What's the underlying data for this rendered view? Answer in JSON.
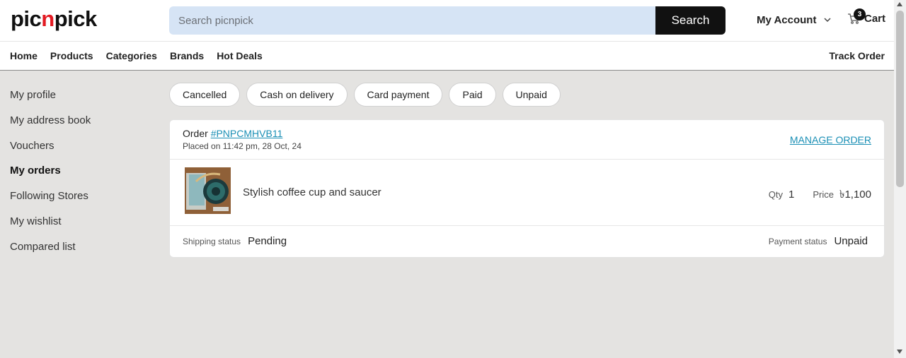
{
  "header": {
    "logo_pre": "pic",
    "logo_n": "n",
    "logo_post": "pick",
    "search_placeholder": "Search picnpick",
    "search_button": "Search",
    "account_label": "My Account",
    "cart_label": "Cart",
    "cart_count": "3"
  },
  "nav": {
    "items": [
      "Home",
      "Products",
      "Categories",
      "Brands",
      "Hot Deals"
    ],
    "track_order": "Track Order"
  },
  "sidebar": {
    "items": [
      "My profile",
      "My address book",
      "Vouchers",
      "My orders",
      "Following Stores",
      "My wishlist",
      "Compared list"
    ],
    "active": "My orders"
  },
  "filters": [
    "Cancelled",
    "Cash on delivery",
    "Card payment",
    "Paid",
    "Unpaid"
  ],
  "order": {
    "label": "Order ",
    "id": "#PNPCMHVB11",
    "placed": "Placed on 11:42 pm, 28 Oct, 24",
    "manage": "MANAGE ORDER",
    "item": {
      "name": "Stylish coffee cup and saucer",
      "qty_label": "Qty",
      "qty": "1",
      "price_label": "Price",
      "price": "৳1,100"
    },
    "shipping_label": "Shipping status",
    "shipping_status": "Pending",
    "payment_label": "Payment status",
    "payment_status": "Unpaid"
  },
  "colors": {
    "brand_red": "#e31b23",
    "link": "#1a8fb5",
    "search_bg": "#d6e4f5",
    "page_bg": "#e4e3e1"
  },
  "icons": [
    "chevron-down-icon",
    "cart-icon",
    "product-thumbnail"
  ]
}
